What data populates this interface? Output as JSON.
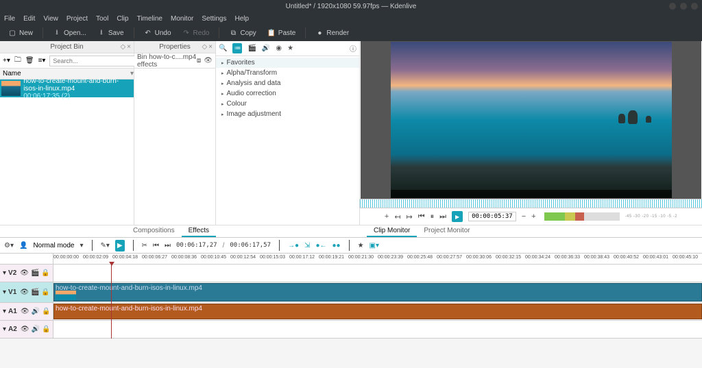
{
  "titlebar": "Untitled* / 1920x1080 59.97fps — Kdenlive",
  "menu": [
    "File",
    "Edit",
    "View",
    "Project",
    "Tool",
    "Clip",
    "Timeline",
    "Monitor",
    "Settings",
    "Help"
  ],
  "toolbar": {
    "new": "New",
    "open": "Open...",
    "save": "Save",
    "undo": "Undo",
    "redo": "Redo",
    "copy": "Copy",
    "paste": "Paste",
    "render": "Render"
  },
  "panels": {
    "bin": "Project Bin",
    "props": "Properties"
  },
  "bin": {
    "search_ph": "Search...",
    "col_name": "Name",
    "clip_name": "how-to-create-mount-and-burn-isos-in-linux.mp4",
    "clip_dur": "00:06:17:35 (2)"
  },
  "props": {
    "title": "Bin how-to-c....mp4 effects"
  },
  "effects": {
    "items": [
      "Favorites",
      "Alpha/Transform",
      "Analysis and data",
      "Audio correction",
      "Colour",
      "Image adjustment"
    ]
  },
  "tabs_left": {
    "compositions": "Compositions",
    "effects": "Effects"
  },
  "tabs_right": {
    "clip": "Clip Monitor",
    "project": "Project Monitor"
  },
  "monitor": {
    "tc": "00:00:05:37",
    "levels": "-45  -30  -20  -15  -10  -5   -2"
  },
  "tltools": {
    "mode": "Normal mode",
    "tc1": "00:06:17,27",
    "tc2": "00:06:17,57"
  },
  "ruler": [
    "00:00:00:00",
    "00:00:02:09",
    "00:00:04:18",
    "00:00:06:27",
    "00:00:08:36",
    "00:00:10:45",
    "00:00:12:54",
    "00:00:15:03",
    "00:00:17:12",
    "00:00:19:21",
    "00:00:21:30",
    "00:00:23:39",
    "00:00:25:48",
    "00:00:27:57",
    "00:00:30:06",
    "00:00:32:15",
    "00:00:34:24",
    "00:00:36:33",
    "00:00:38:43",
    "00:00:40:52",
    "00:00:43:01",
    "00:00:45:10"
  ],
  "tracks": {
    "v2": "V2",
    "v1": "V1",
    "a1": "A1",
    "a2": "A2"
  },
  "tlclips": {
    "video": "how-to-create-mount-and-burn-isos-in-linux.mp4",
    "audio": "how-to-create-mount-and-burn-isos-in-linux.mp4"
  }
}
